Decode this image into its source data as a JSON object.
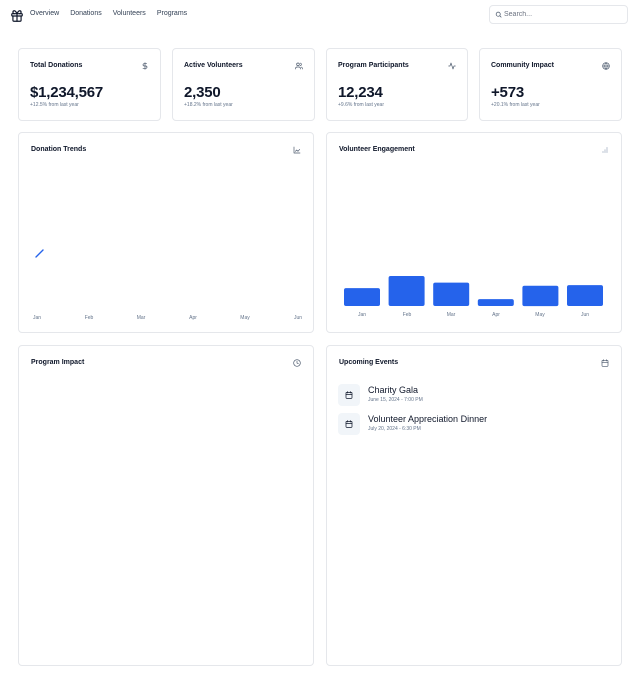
{
  "nav": {
    "logo_icon": "gift-icon",
    "items": [
      "Overview",
      "Donations",
      "Volunteers",
      "Programs"
    ]
  },
  "search": {
    "placeholder": "Search...",
    "icon": "search-icon"
  },
  "stats": [
    {
      "title": "Total Donations",
      "value": "$1,234,567",
      "sub": "+12.5% from last year",
      "icon": "dollar-icon"
    },
    {
      "title": "Active Volunteers",
      "value": "2,350",
      "sub": "+18.2% from last year",
      "icon": "users-icon"
    },
    {
      "title": "Program Participants",
      "value": "12,234",
      "sub": "+9.6% from last year",
      "icon": "activity-icon"
    },
    {
      "title": "Community Impact",
      "value": "+573",
      "sub": "+20.1% from last year",
      "icon": "globe-icon"
    }
  ],
  "donation_trends": {
    "title": "Donation Trends",
    "icon": "line-chart-icon"
  },
  "volunteer_engagement": {
    "title": "Volunteer Engagement",
    "icon": "bar-chart-icon"
  },
  "program_impact": {
    "title": "Program Impact",
    "icon": "pie-chart-icon"
  },
  "upcoming_events": {
    "title": "Upcoming Events",
    "icon": "calendar-icon",
    "events": [
      {
        "name": "Charity Gala",
        "date": "June 15, 2024 - 7:00 PM"
      },
      {
        "name": "Volunteer Appreciation Dinner",
        "date": "July 20, 2024 - 6:30 PM"
      }
    ]
  },
  "colors": {
    "accent": "#2563eb",
    "border": "#e5e7eb",
    "muted": "#64748b"
  },
  "chart_data": [
    {
      "type": "line",
      "categories": [
        "Jan",
        "Feb",
        "Mar",
        "Apr",
        "May",
        "Jun"
      ],
      "series": [
        {
          "values": [
            null,
            null,
            null,
            null,
            null,
            null
          ]
        }
      ],
      "title": "Donation Trends",
      "grid": false
    },
    {
      "type": "bar",
      "categories": [
        "Jan",
        "Feb",
        "Mar",
        "Apr",
        "May",
        "Jun"
      ],
      "values": [
        65,
        109,
        85,
        25,
        74,
        76
      ],
      "title": "Volunteer Engagement",
      "ylim": [
        0,
        400
      ],
      "grid": false
    }
  ]
}
